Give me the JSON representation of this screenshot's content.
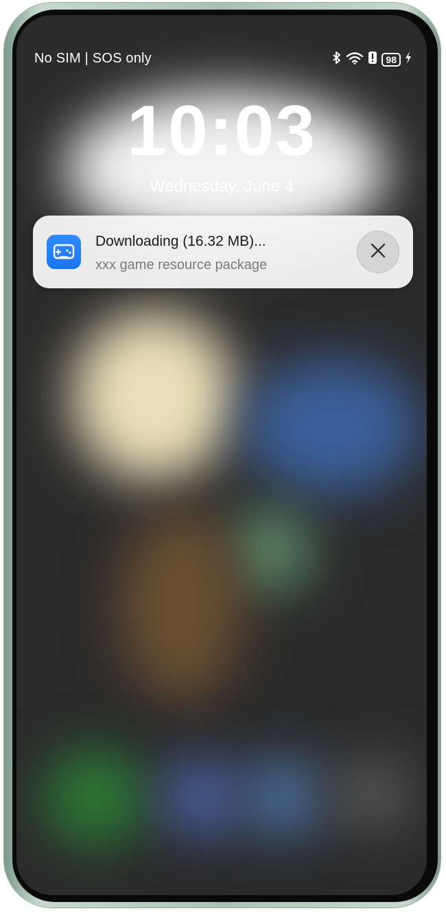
{
  "status_bar": {
    "carrier": "No SIM | SOS only",
    "battery_level": "98",
    "icons": [
      "bluetooth-icon",
      "wifi-icon",
      "alert-icon",
      "battery-icon",
      "charging-icon"
    ]
  },
  "lock_screen": {
    "time": "10:03",
    "date": "Wednesday, June 4"
  },
  "notification": {
    "icon": "gamepad-icon",
    "title": "Downloading (16.32 MB)...",
    "subtitle": "xxx game resource package",
    "close_icon": "close-icon"
  },
  "colors": {
    "app_icon": "#1b74f0",
    "notification_bg": "#f4f4f4",
    "close_button_bg": "#d4d4d4",
    "frame": "#a9c2b4"
  }
}
